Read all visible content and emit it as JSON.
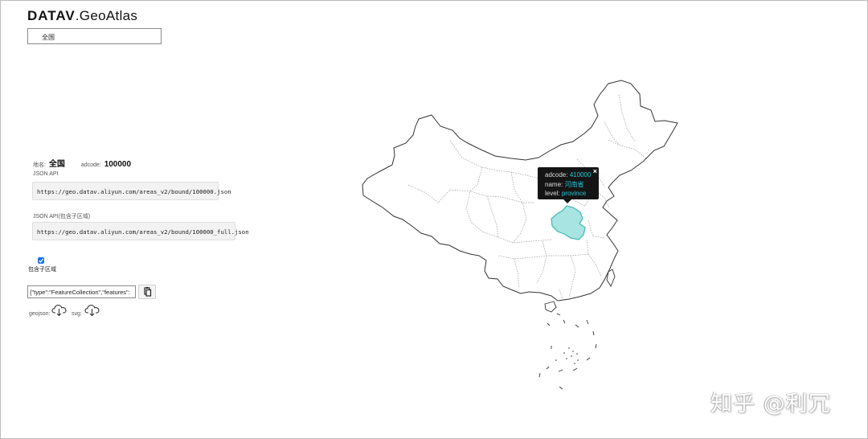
{
  "header": {
    "logo_bold": "DATAV",
    "logo_rest": ".GeoAtlas"
  },
  "region_select": {
    "value": "全国"
  },
  "info": {
    "name_label": "地名:",
    "name_value": "全国",
    "adcode_label": "adcode:",
    "adcode_value": "100000"
  },
  "json_api": {
    "label": "JSON API",
    "url": "https://geo.datav.aliyun.com/areas_v2/bound/100000.json"
  },
  "json_api_full": {
    "label": "JSON API(包含子区域)",
    "url": "https://geo.datav.aliyun.com/areas_v2/bound/100000_full.json"
  },
  "include_children": {
    "checked": true,
    "label": "包含子区域"
  },
  "geojson_output": {
    "value": "{\"type\":\"FeatureCollection\",\"features\":"
  },
  "downloads": {
    "geojson_label": "geojson:",
    "svg_label": "svg:"
  },
  "tooltip": {
    "adcode_label": "adcode:",
    "adcode_value": "410000",
    "name_label": "name:",
    "name_value": "河南省",
    "level_label": "level:",
    "level_value": "province",
    "close": "×"
  },
  "colors": {
    "highlight_fill": "#a8e4e2",
    "highlight_stroke": "#3fb8b3",
    "tooltip_bg": "#141414",
    "tooltip_value": "#22c7d6",
    "checkbox": "#1a73e8"
  },
  "icons": [
    "copy-icon",
    "cloud-download-icon",
    "close-icon",
    "checkmark-icon"
  ],
  "watermark": "知乎 @利冗"
}
